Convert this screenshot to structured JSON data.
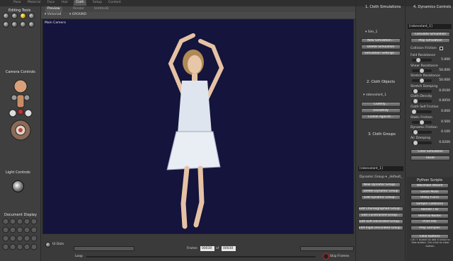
{
  "top_tabs": [
    "Pose",
    "Material",
    "Face",
    "Hair",
    "Cloth",
    "Setup",
    "Content"
  ],
  "active_tab_index": 4,
  "left": {
    "editing_tools": "Editing Tools",
    "camera_controls": "Camera Controls",
    "light_controls": "Light Controls",
    "document_display": "Document Display"
  },
  "viewport": {
    "tabs": [
      "Preview",
      "Render",
      "Untitled2"
    ],
    "figure_dropdown": "Victoria4",
    "actor_dropdown": "GROUND",
    "camera_label": "Main Camera",
    "background": "#14143c"
  },
  "bottom": {
    "ui_dots": "UI Dots",
    "frame_label": "Frame:",
    "frame_value": "00030",
    "of_label": "of",
    "frame_total": "00030",
    "loop_label": "Loop",
    "skip_frames_label": "Skip Frames"
  },
  "cloth_sims": {
    "header": "1. Cloth Simulations",
    "sim_dropdown": "Sim_1",
    "buttons": [
      "New Simulation...",
      "Delete Simulation",
      "Simulation Settings..."
    ]
  },
  "cloth_objects": {
    "header": "2. Cloth Objects",
    "dropdown": "robevolant_1",
    "buttons": [
      "Clothify...",
      "Unclothify",
      "Collide Against..."
    ]
  },
  "cloth_groups": {
    "header": "3. Cloth Groups",
    "object_field": "[robevolant_1]",
    "group_dropdown": "Dynamic Group ▾ _default_",
    "buttons": [
      "New Dynamic Group...",
      "Delete Dynamic Group",
      "Edit Dynamic Group...",
      "Edit Choreographed Group...",
      "Edit Constrained Group...",
      "Edit Soft Decorated Group...",
      "Edit Rigid Decorated Group..."
    ]
  },
  "dynamics": {
    "header": "4. Dynamics Controls",
    "object_field": "[robevolant_1]",
    "calc_button": "Calculate Simulation",
    "play_button": "Play Simulation",
    "collision_friction": "Collision Friction",
    "params": [
      {
        "label": "Fold Resistance",
        "value": "5.000",
        "fill": 0.25
      },
      {
        "label": "Shear Resistance",
        "value": "50.000",
        "fill": 0.5
      },
      {
        "label": "Stretch Resistance",
        "value": "50.000",
        "fill": 0.5
      },
      {
        "label": "Stretch Damping",
        "value": "0.0100",
        "fill": 0.1
      },
      {
        "label": "Cloth Density",
        "value": "0.0050",
        "fill": 0.1
      },
      {
        "label": "Cloth Self Friction",
        "value": "0.000",
        "fill": 0.0
      },
      {
        "label": "Static Friction",
        "value": "0.500",
        "fill": 0.5
      },
      {
        "label": "Dynamic Friction",
        "value": "0.100",
        "fill": 0.1
      },
      {
        "label": "Air Damping",
        "value": "0.0200",
        "fill": 0.1
      }
    ],
    "clear_button": "Clear Simulation",
    "reset_button": "Reset"
  },
  "python": {
    "header": "Python Scripts",
    "buttons": [
      "Wardrobe Wizard",
      "Geom Mods",
      "Utility Funcs",
      "Sample Callbacks",
      "Render / ID",
      "Referral Nodes",
      "Print Info",
      "Prop Samples",
      "Clear buttons"
    ],
    "hint": "Ctrl + button to add a script to that button. Ctrl-click to clear button."
  }
}
